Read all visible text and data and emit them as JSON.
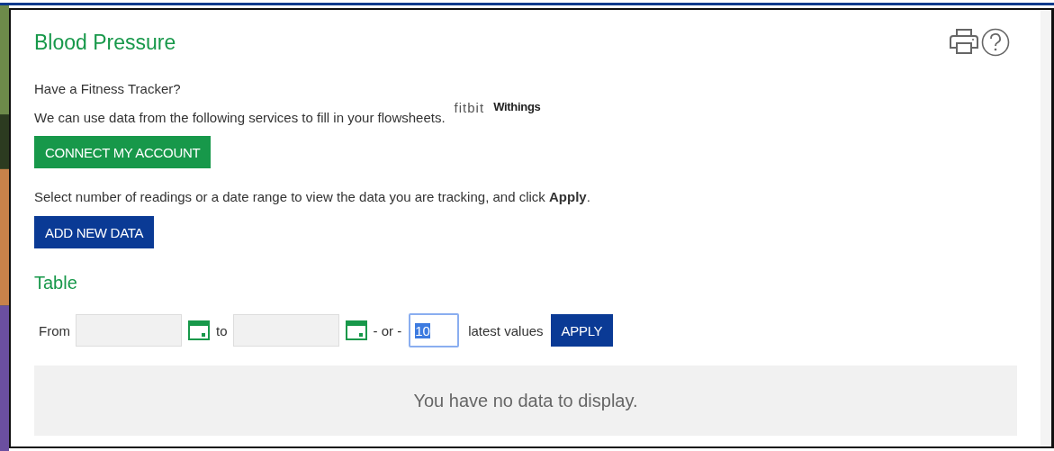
{
  "panel": {
    "title": "Blood Pressure"
  },
  "tracker": {
    "question": "Have a Fitness Tracker?",
    "text": "We can use data from the following services to fill in your flowsheets.",
    "services": [
      {
        "kind": "fitbit",
        "label": "fitbit"
      },
      {
        "kind": "withings",
        "label": "Withings"
      }
    ],
    "connect_button": "CONNECT MY ACCOUNT"
  },
  "instructions": "Select number of readings or a date range to view the data you are tracking, and click **Apply**.",
  "add_button": "ADD NEW DATA",
  "section_title": "Table",
  "filter": {
    "from_label": "From",
    "to_label": "to",
    "or_label": "- or -",
    "count_value": "10",
    "count_selected": true,
    "count_label": "latest values",
    "apply_button": "APPLY"
  },
  "empty_message": "You have no data to display."
}
